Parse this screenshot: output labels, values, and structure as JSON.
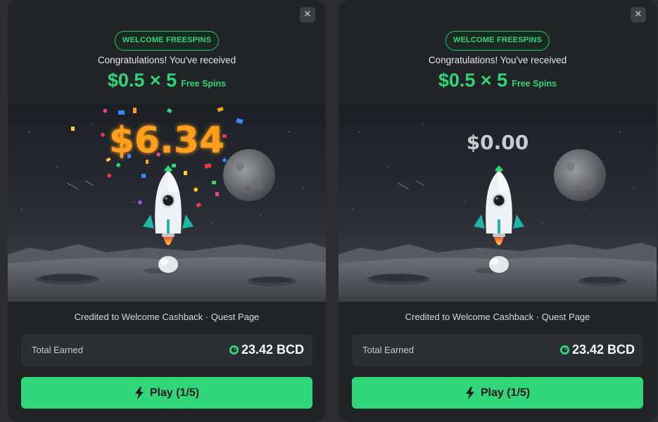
{
  "panels": [
    {
      "close_icon": "close-icon",
      "badge": "WELCOME FREESPINS",
      "congrats": "Congratulations! You've received",
      "spin_amount": "$0.5 × 5",
      "spin_label": "Free Spins",
      "prize": "$6.34",
      "prize_state": "won",
      "credit_text": "Credited to Welcome Cashback · Quest Page",
      "total_label": "Total Earned",
      "total_value": "23.42 BCD",
      "play_label": "Play (1/5)"
    },
    {
      "close_icon": "close-icon",
      "badge": "WELCOME FREESPINS",
      "congrats": "Congratulations! You've received",
      "spin_amount": "$0.5 × 5",
      "spin_label": "Free Spins",
      "prize": "$0.00",
      "prize_state": "idle",
      "credit_text": "Credited to Welcome Cashback · Quest Page",
      "total_label": "Total Earned",
      "total_value": "23.42 BCD",
      "play_label": "Play (1/5)"
    }
  ],
  "icons": {
    "close": "close-icon",
    "coin": "bcd-coin-icon",
    "play": "lightning-bolt-icon"
  },
  "colors": {
    "accent": "#2fd779",
    "prize_won": "#ff9f1c",
    "prize_idle": "#c9ccd0",
    "modal_bg": "#212427"
  }
}
